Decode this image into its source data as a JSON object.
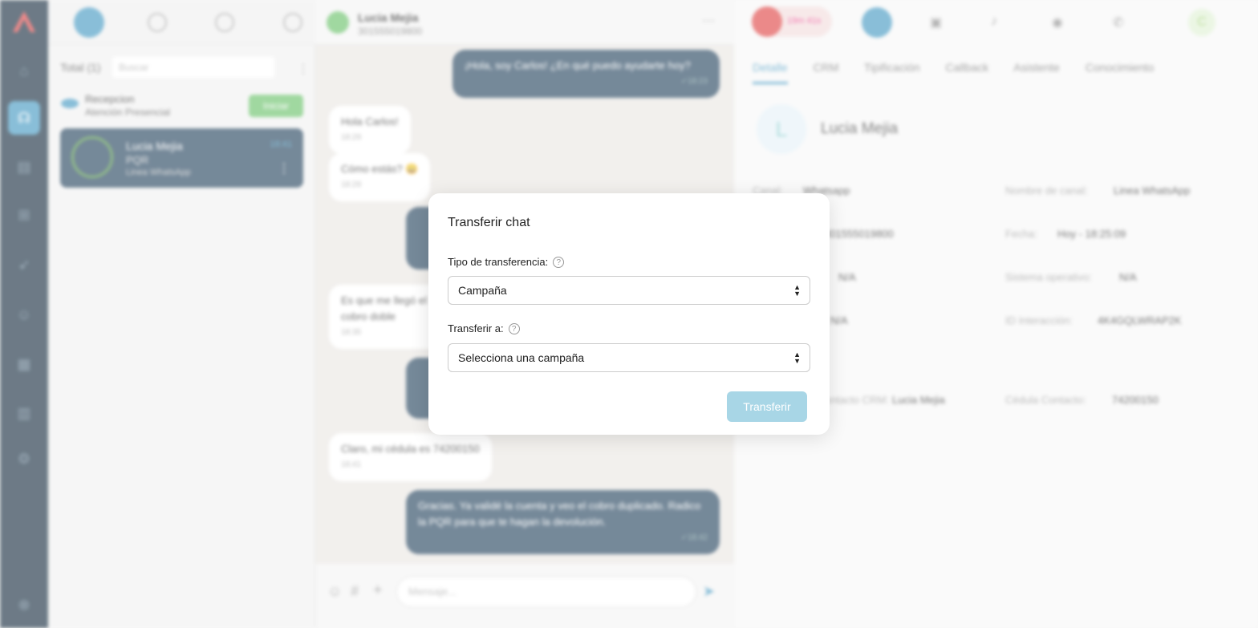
{
  "rail": {
    "icons": [
      "logo",
      "home-icon",
      "headset-icon",
      "contacts-icon",
      "flows-icon",
      "rocket-icon",
      "bot-icon",
      "calendar-icon",
      "reports-icon",
      "settings-icon",
      "help-icon"
    ]
  },
  "list": {
    "total": "Total (1)",
    "search_placeholder": "Buscar",
    "reception": {
      "name": "Recepcion",
      "subtitle": "Atención Presencial",
      "button": "Iniciar"
    },
    "conversation": {
      "name": "Lucia Mejia",
      "topic": "PQR",
      "line": "Linea WhatsApp",
      "time": "18:41"
    }
  },
  "chat": {
    "contact": "Lucia Mejia",
    "phone": "301555019800",
    "messages": [
      {
        "dir": "out",
        "text": "¡Hola, soy Carlos! ¿En qué puedo ayudarte hoy?",
        "time": "✓18:23"
      },
      {
        "dir": "in",
        "text": "Hola Carlos!",
        "time": "18:29"
      },
      {
        "dir": "in",
        "text": "Cómo estás? 😀",
        "time": "18:29"
      },
      {
        "dir": "in",
        "text": "Es que me llegó el cobro doble",
        "time": "18:35"
      },
      {
        "dir": "in",
        "text": "Claro, mi cédula es 74200150",
        "time": "18:41"
      },
      {
        "dir": "out",
        "text": "Gracias. Ya validé la cuenta y veo el cobro duplicado. Radico la PQR para que te hagan la devolución.",
        "time": "✓18:42"
      }
    ],
    "composer_placeholder": "Mensaje..."
  },
  "right": {
    "status_timer": "19m 41s",
    "tabs": [
      "Detalle",
      "CRM",
      "Tipificación",
      "Callback",
      "Asistente",
      "Conocimiento"
    ],
    "contact_initial": "L",
    "contact_name": "Lucia Mejia",
    "fields": {
      "canal_label": "Canal:",
      "canal_value": "Whatsapp",
      "nombre_canal_label": "Nombre de canal:",
      "nombre_canal_value": "Linea WhatsApp",
      "phone_value": "301555019800",
      "fecha_label": "Fecha:",
      "fecha_value": "Hoy - 18:25:09",
      "na1": "N/A",
      "so_label": "Sistema operativo:",
      "so_value": "N/A",
      "na2": "N/A",
      "id_label": "ID Interacción:",
      "id_value": "4K4GQLWRAP2K",
      "crm_label": "Contacto CRM:",
      "crm_value": "Lucia Mejia",
      "cedula_label": "Cédula Contacto:",
      "cedula_value": "74200150"
    },
    "user_initial": "C"
  },
  "dialog": {
    "title": "Transferir chat",
    "type_label": "Tipo de transferencia:",
    "type_value": "Campaña",
    "to_label": "Transferir a:",
    "to_value": "Selecciona una campaña",
    "submit": "Transferir",
    "help_glyph": "?"
  }
}
